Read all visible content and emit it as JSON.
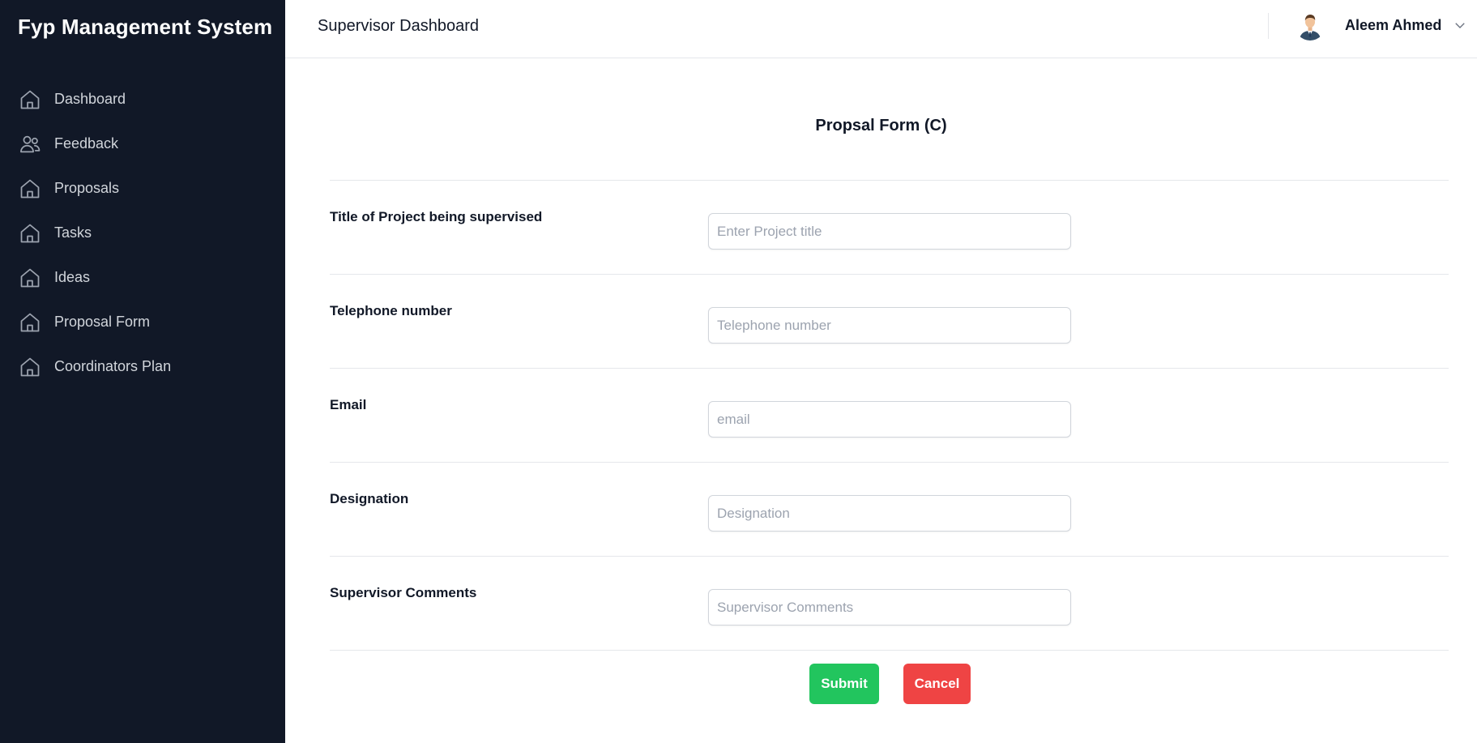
{
  "brand": "Fyp Management System",
  "sidebar": {
    "items": [
      {
        "label": "Dashboard",
        "icon": "home-icon"
      },
      {
        "label": "Feedback",
        "icon": "users-icon"
      },
      {
        "label": "Proposals",
        "icon": "home-icon"
      },
      {
        "label": "Tasks",
        "icon": "home-icon"
      },
      {
        "label": "Ideas",
        "icon": "home-icon"
      },
      {
        "label": "Proposal Form",
        "icon": "home-icon"
      },
      {
        "label": "Coordinators Plan",
        "icon": "home-icon"
      }
    ]
  },
  "header": {
    "title": "Supervisor Dashboard",
    "user_name": "Aleem Ahmed"
  },
  "form": {
    "title": "Propsal Form (C)",
    "fields": [
      {
        "label": "Title of Project being supervised",
        "placeholder": "Enter Project title",
        "value": ""
      },
      {
        "label": "Telephone number",
        "placeholder": "Telephone number",
        "value": ""
      },
      {
        "label": "Email",
        "placeholder": "email",
        "value": ""
      },
      {
        "label": "Designation",
        "placeholder": "Designation",
        "value": ""
      },
      {
        "label": "Supervisor Comments",
        "placeholder": "Supervisor Comments",
        "value": ""
      }
    ],
    "submit_label": "Submit",
    "cancel_label": "Cancel"
  },
  "colors": {
    "sidebar_bg": "#111827",
    "submit": "#22c55e",
    "cancel": "#ef4444"
  }
}
